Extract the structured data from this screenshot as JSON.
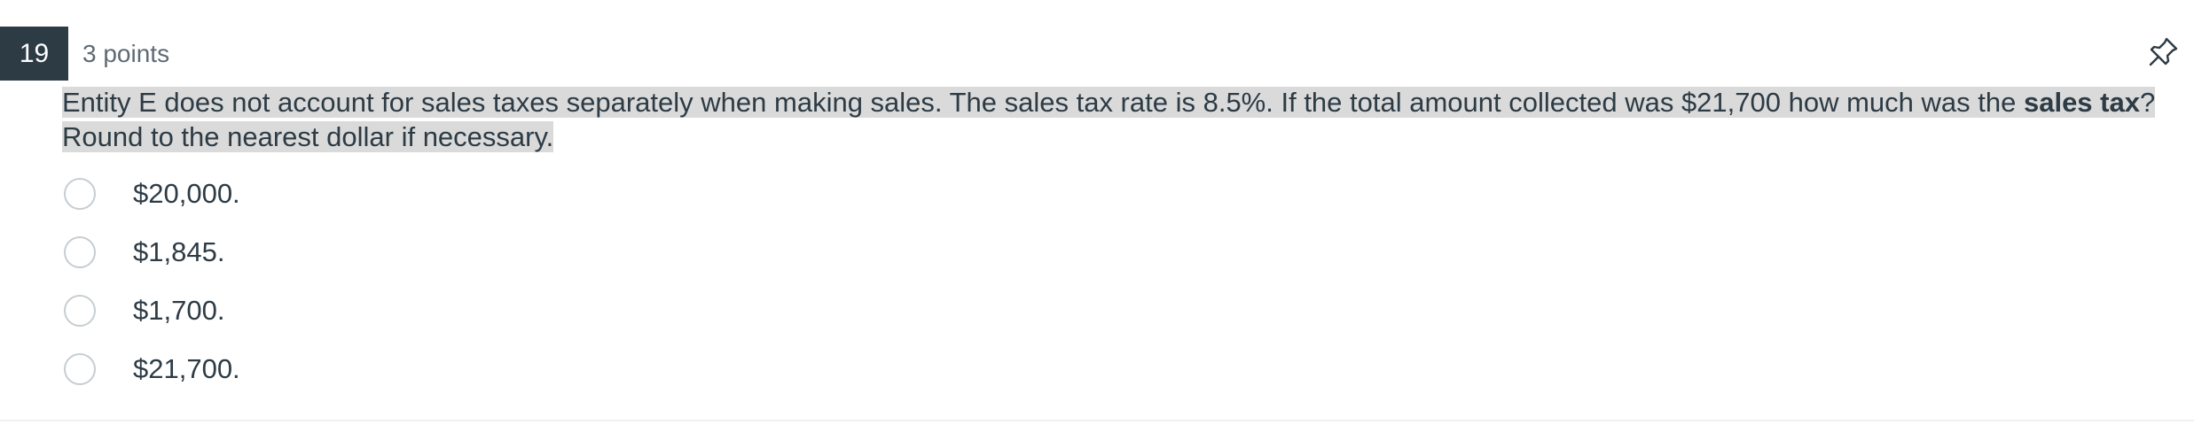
{
  "question": {
    "number": "19",
    "points": "3 points",
    "text_part1": "Entity E does not account for sales taxes separately when making sales.  The sales tax rate is 8.5%.  If the total amount collected was $21,700 how much was the ",
    "text_bold": "sales tax",
    "text_part2": "? Round to the nearest dollar if necessary.",
    "pin_icon": "pin-icon"
  },
  "answers": [
    {
      "label": "$20,000."
    },
    {
      "label": "$1,845."
    },
    {
      "label": "$1,700."
    },
    {
      "label": "$21,700."
    }
  ],
  "colors": {
    "number_badge_bg": "#2d3b45",
    "text": "#2d3b45",
    "highlight": "#dadada",
    "radio_border": "#c7cdd1"
  }
}
